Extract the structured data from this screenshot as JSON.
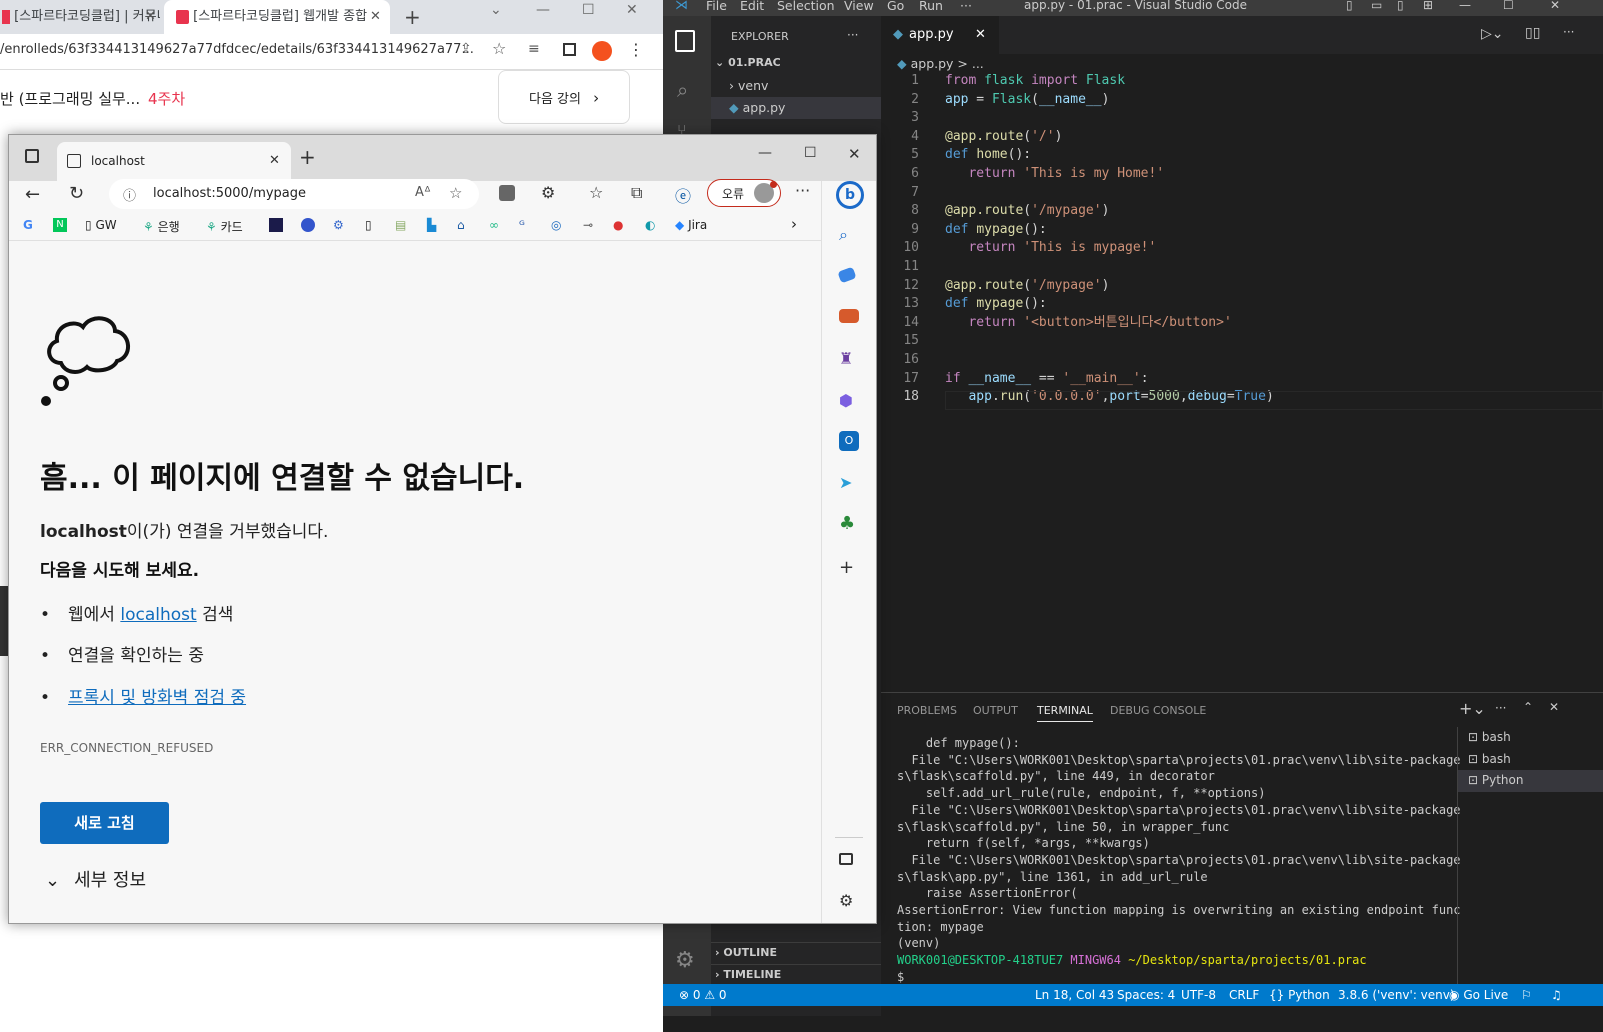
{
  "bg_chrome": {
    "tabs": [
      "[스파르타코딩클럽] | 커뮤니티",
      "[스파르타코딩클럽] 웹개발 종합"
    ],
    "new_tab": "+",
    "url": "/enrolleds/63f334413149627a77dfdcec/edetails/63f334413149627a77...",
    "course_title": "반 (프로그래밍 실무...",
    "week": "4주차",
    "next_button": "다음 강의"
  },
  "vscode": {
    "menu": [
      "File",
      "Edit",
      "Selection",
      "View",
      "Go",
      "Run",
      "···"
    ],
    "window_title": "app.py - 01.prac - Visual Studio Code",
    "explorer_label": "EXPLORER",
    "explorer_more": "···",
    "folder": "01.PRAC",
    "tree": [
      "venv",
      "app.py"
    ],
    "tab_name": "app.py",
    "breadcrumb": "app.py > ...",
    "outline": "OUTLINE",
    "timeline": "TIMELINE",
    "code_lines": [
      "from flask import Flask",
      "app = Flask(__name__)",
      "",
      "@app.route('/')",
      "def home():",
      "   return 'This is my Home!'",
      "",
      "@app.route('/mypage')",
      "def mypage():",
      "   return 'This is mypage!'",
      "",
      "@app.route('/mypage')",
      "def mypage():",
      "   return '<button>버튼입니다</button>'",
      "",
      "",
      "if __name__ == '__main__':",
      "   app.run('0.0.0.0',port=5000,debug=True)"
    ],
    "panel_tabs": [
      "PROBLEMS",
      "OUTPUT",
      "TERMINAL",
      "DEBUG CONSOLE"
    ],
    "terminal_lines": [
      "    def mypage():",
      "  File \"C:\\Users\\WORK001\\Desktop\\sparta\\projects\\01.prac\\venv\\lib\\site-package",
      "s\\flask\\scaffold.py\", line 449, in decorator",
      "    self.add_url_rule(rule, endpoint, f, **options)",
      "  File \"C:\\Users\\WORK001\\Desktop\\sparta\\projects\\01.prac\\venv\\lib\\site-package",
      "s\\flask\\scaffold.py\", line 50, in wrapper_func",
      "    return f(self, *args, **kwargs)",
      "  File \"C:\\Users\\WORK001\\Desktop\\sparta\\projects\\01.prac\\venv\\lib\\site-package",
      "s\\flask\\app.py\", line 1361, in add_url_rule",
      "    raise AssertionError(",
      "AssertionError: View function mapping is overwriting an existing endpoint func",
      "tion: mypage",
      "(venv)"
    ],
    "prompt_user": "WORK001@DESKTOP-418TUE7",
    "prompt_env": "MINGW64",
    "prompt_path": "~/Desktop/sparta/projects/01.prac",
    "prompt_symbol": "$",
    "terminals": [
      "bash",
      "bash",
      "Python"
    ],
    "status": {
      "errors": "⊗ 0 ⚠ 0",
      "position": "Ln 18, Col 43",
      "spaces": "Spaces: 4",
      "encoding": "UTF-8",
      "eol": "CRLF",
      "language": "Python",
      "interpreter": "3.8.6 ('venv': venv)",
      "golive": "Go Live"
    }
  },
  "edge": {
    "tab_title": "localhost",
    "url": "localhost:5000/mypage",
    "error_badge": "오류",
    "favorites": [
      "GW",
      "은행",
      "카드",
      "Jira"
    ],
    "error_heading": "흠... 이 페이지에 연결할 수 없습니다.",
    "refused_host": "localhost",
    "refused_text": "이(가) 연결을 거부했습니다.",
    "try_heading": "다음을 시도해 보세요.",
    "suggest_1_prefix": "웹에서 ",
    "suggest_1_link": "localhost",
    "suggest_1_suffix": " 검색",
    "suggest_2": "연결을 확인하는 중",
    "suggest_3": "프록시 및 방화벽 점검 중",
    "error_code": "ERR_CONNECTION_REFUSED",
    "reload_button": "새로 고침",
    "details": "세부 정보"
  }
}
